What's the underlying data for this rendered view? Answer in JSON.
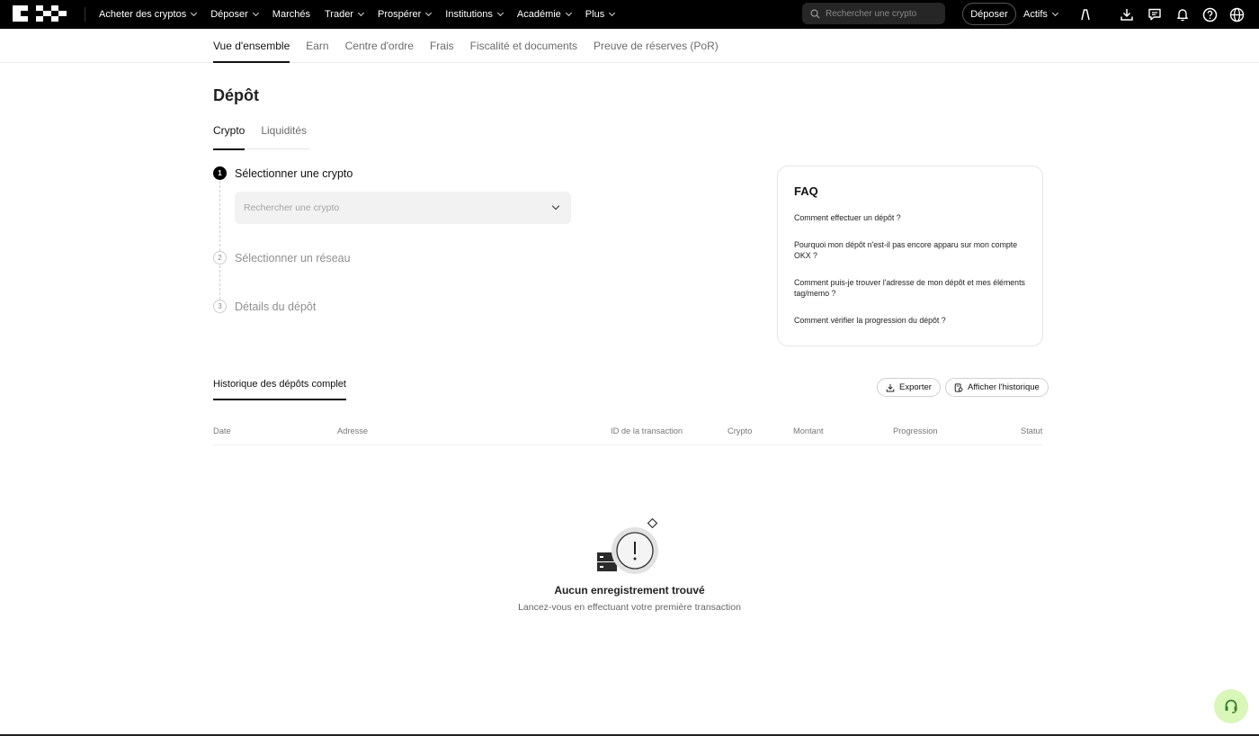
{
  "topbar": {
    "nav": [
      {
        "label": "Acheter des cryptos",
        "has_dropdown": true
      },
      {
        "label": "Déposer",
        "has_dropdown": true
      },
      {
        "label": "Marchés",
        "has_dropdown": false
      },
      {
        "label": "Trader",
        "has_dropdown": true
      },
      {
        "label": "Prospérer",
        "has_dropdown": true
      },
      {
        "label": "Institutions",
        "has_dropdown": true
      },
      {
        "label": "Académie",
        "has_dropdown": true
      },
      {
        "label": "Plus",
        "has_dropdown": true
      }
    ],
    "search_placeholder": "Rechercher une crypto",
    "deposit_button": "Déposer",
    "assets_label": "Actifs",
    "icons": [
      "user-icon",
      "download-icon",
      "message-icon",
      "bell-icon",
      "help-icon",
      "globe-icon"
    ]
  },
  "subnav": {
    "tabs": [
      "Vue d'ensemble",
      "Earn",
      "Centre d'ordre",
      "Frais",
      "Fiscalité et documents",
      "Preuve de réserves (PoR)"
    ],
    "active": 0
  },
  "page": {
    "title": "Dépôt",
    "tabs": [
      "Crypto",
      "Liquidités"
    ],
    "active_tab": 0
  },
  "steps": [
    {
      "number": "1",
      "label": "Sélectionner une crypto",
      "state": "active"
    },
    {
      "number": "2",
      "label": "Sélectionner un réseau",
      "state": "pending"
    },
    {
      "number": "3",
      "label": "Détails du dépôt",
      "state": "pending"
    }
  ],
  "crypto_select": {
    "placeholder": "Rechercher une crypto"
  },
  "faq": {
    "title": "FAQ",
    "items": [
      "Comment effectuer un dépôt ?",
      "Pourquoi mon dépôt n'est-il pas encore apparu sur mon compte OKX ?",
      "Comment puis-je trouver l'adresse de mon dépôt et mes éléments tag/memo ?",
      "Comment vérifier la progression du dépôt ?"
    ]
  },
  "history": {
    "tab": "Historique des dépôts complet",
    "export_label": "Exporter",
    "view_history_label": "Afficher l'historique",
    "columns": [
      "Date",
      "Adresse",
      "ID de la transaction",
      "Crypto",
      "Montant",
      "Progression",
      "Statut"
    ],
    "empty_title": "Aucun enregistrement trouvé",
    "empty_subtitle": "Lancez-vous en effectuant votre première transaction"
  },
  "colors": {
    "topbar_bg": "#000000",
    "support_bg": "#d9f7b9",
    "support_icon": "#3a7d2a"
  }
}
